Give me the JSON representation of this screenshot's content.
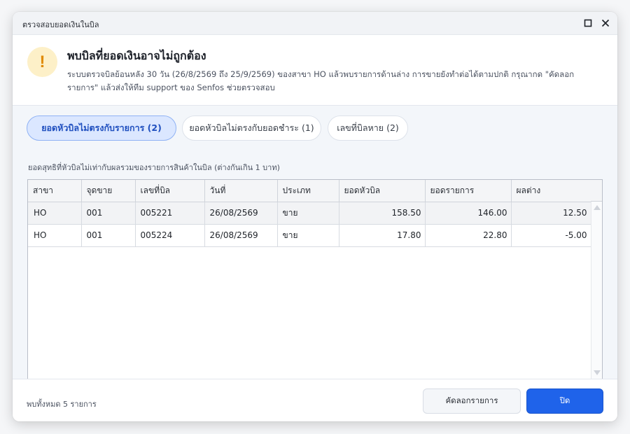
{
  "window": {
    "title": "ตรวจสอบยอดเงินในบิล",
    "maximize_icon": "maximize-icon",
    "close_icon": "close-icon"
  },
  "alert": {
    "icon": "warning-icon",
    "icon_glyph": "!",
    "heading": "พบบิลที่ยอดเงินอาจไม่ถูกต้อง",
    "description": "ระบบตรวจบิลย้อนหลัง 30 วัน (26/8/2569 ถึง 25/9/2569) ของสาขา HO แล้วพบรายการด้านล่าง การขายยังทำต่อได้ตามปกติ กรุณากด \"คัดลอกรายการ\" แล้วส่งให้ทีม support ของ Senfos ช่วยตรวจสอบ"
  },
  "tabs": [
    {
      "label": "ยอดหัวบิลไม่ตรงกับรายการ (2)",
      "active": true
    },
    {
      "label": "ยอดหัวบิลไม่ตรงกับยอดชำระ (1)",
      "active": false
    },
    {
      "label": "เลขที่บิลหาย (2)",
      "active": false
    }
  ],
  "table": {
    "caption": "ยอดสุทธิที่หัวบิลไม่เท่ากับผลรวมของรายการสินค้าในบิล (ต่างกันเกิน 1 บาท)",
    "columns": [
      "สาขา",
      "จุดขาย",
      "เลขที่บิล",
      "วันที่",
      "ประเภท",
      "ยอดหัวบิล",
      "ยอดรายการ",
      "ผลต่าง"
    ],
    "rows": [
      [
        "HO",
        "001",
        "005221",
        "26/08/2569",
        "ขาย",
        "158.50",
        "146.00",
        "12.50"
      ],
      [
        "HO",
        "001",
        "005224",
        "26/08/2569",
        "ขาย",
        "17.80",
        "22.80",
        "-5.00"
      ]
    ]
  },
  "footer": {
    "count_text": "พบทั้งหมด 5 รายการ",
    "copy_label": "คัดลอกรายการ",
    "close_label": "ปิด"
  },
  "colors": {
    "primary": "#1f63ea",
    "active_tab_bg": "#dbe7ff",
    "warning_bg": "#fdf0c8",
    "warning_fg": "#e08a00"
  }
}
